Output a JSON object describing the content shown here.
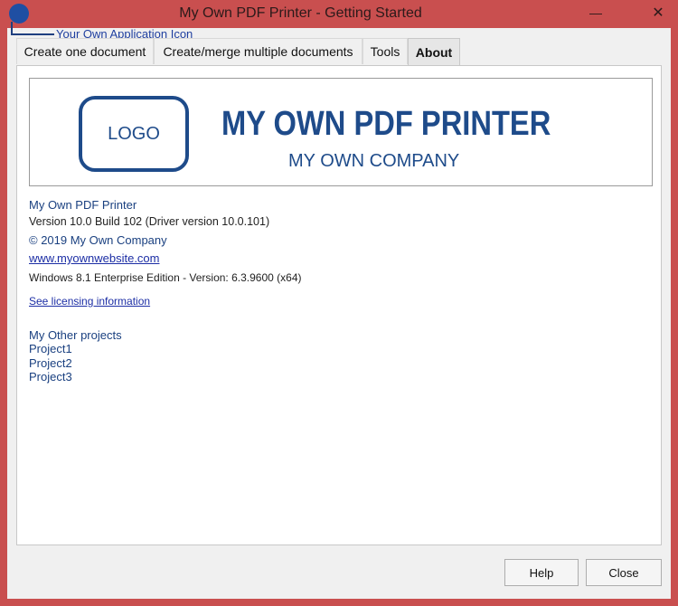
{
  "window": {
    "title": "My Own PDF Printer  -  Getting Started",
    "minimize_glyph": "—",
    "close_glyph": "✕",
    "maximize_glyph": "□"
  },
  "callout": {
    "text": "Your Own Application Icon"
  },
  "tabs": [
    {
      "label": "Create one document",
      "active": false
    },
    {
      "label": "Create/merge multiple documents",
      "active": false
    },
    {
      "label": "Tools",
      "active": false
    },
    {
      "label": "About",
      "active": true
    }
  ],
  "banner": {
    "logo_text": "LOGO",
    "product_name": "MY OWN PDF PRINTER",
    "company_name": "MY OWN COMPANY",
    "brand_color": "#1e4b8a"
  },
  "about": {
    "product": "My Own PDF Printer",
    "version": "Version 10.0 Build 102 (Driver version  10.0.101)",
    "copyright": "© 2019 My Own Company",
    "website": "www.myownwebsite.com",
    "os": "Windows 8.1 Enterprise Edition - Version: 6.3.9600 (x64)",
    "licensing_link": "See licensing information",
    "other_projects_heading": "My Other projects",
    "projects": [
      "Project1",
      "Project2",
      "Project3"
    ]
  },
  "buttons": {
    "help": "Help",
    "close": "Close"
  },
  "colors": {
    "titlebar": "#c94f4f",
    "link": "#1c2ea5",
    "text_blue": "#1a4080"
  }
}
